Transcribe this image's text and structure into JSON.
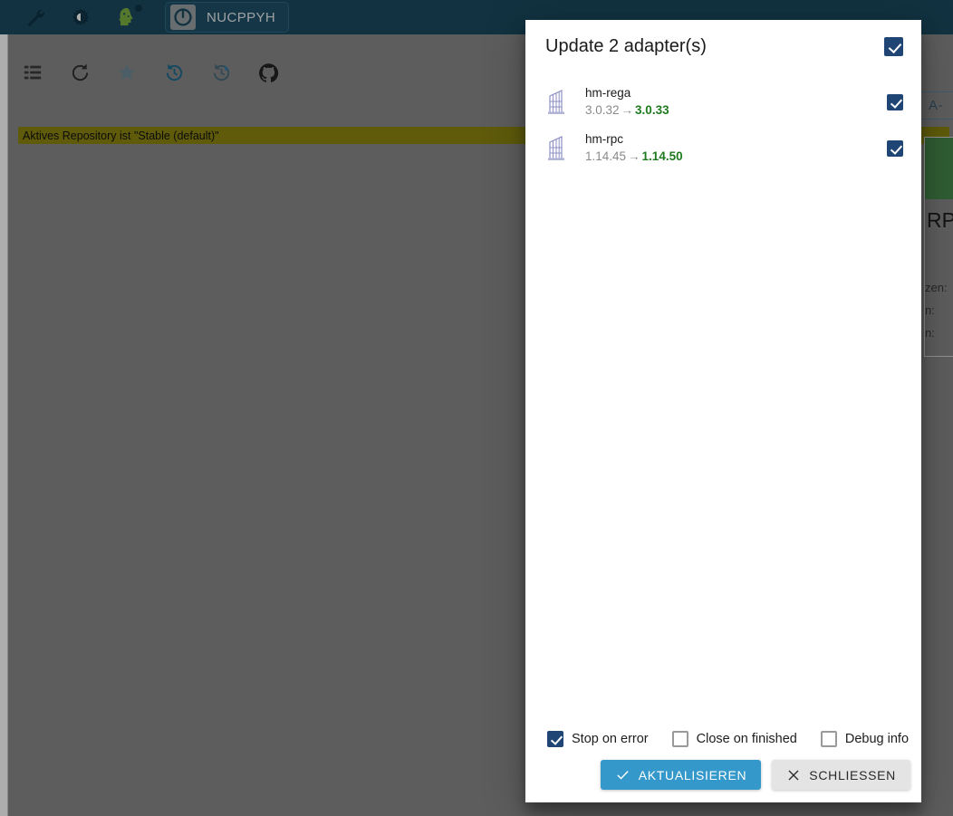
{
  "topbar": {
    "icons": [
      {
        "name": "wrench-icon",
        "label": "Tools"
      },
      {
        "name": "contrast-icon",
        "label": "Theme"
      },
      {
        "name": "head-expert-icon",
        "label": "Expert mode"
      }
    ],
    "host_button": {
      "label": "NUCPPYH",
      "icon": "power-logo-icon"
    }
  },
  "toolbar": {
    "icons": [
      {
        "name": "list-view-icon",
        "label": "List view"
      },
      {
        "name": "refresh-icon",
        "label": "Refresh"
      },
      {
        "name": "star-icon",
        "label": "Favorites"
      },
      {
        "name": "update-available-icon",
        "label": "Check updates"
      },
      {
        "name": "update-all-icon",
        "label": "Update all"
      },
      {
        "name": "github-icon",
        "label": "GitHub"
      }
    ]
  },
  "repository": {
    "banner": "Aktives Repository ist \"Stable (default)\""
  },
  "background": {
    "sliver_button": "A-",
    "sliver_title": "RP(",
    "sliver_lines": [
      "zen:",
      "n:",
      "n:"
    ]
  },
  "dialog": {
    "title": "Update 2 adapter(s)",
    "select_all_checked": true,
    "adapters": [
      {
        "name": "hm-rega",
        "icon": "adapter-icon",
        "version_old": "3.0.32",
        "arrow": "→",
        "version_new": "3.0.33",
        "checked": true
      },
      {
        "name": "hm-rpc",
        "icon": "adapter-icon",
        "version_old": "1.14.45",
        "arrow": "→",
        "version_new": "1.14.50",
        "checked": true
      }
    ],
    "options": [
      {
        "label": "Stop on error",
        "checked": true
      },
      {
        "label": "Close on finished",
        "checked": false
      },
      {
        "label": "Debug info",
        "checked": false
      }
    ],
    "buttons": {
      "confirm": {
        "label": "AKTUALISIEREN",
        "icon": "check-icon"
      },
      "close": {
        "label": "SCHLIESSEN",
        "icon": "close-icon"
      }
    }
  },
  "colors": {
    "topbar": "#1b4a60",
    "accent_primary": "#3498ca",
    "checkbox_checked": "#1e4573",
    "version_new": "#1f7a1f",
    "banner": "#8d8711",
    "backdrop": "rgba(0,0,0,0.32)"
  }
}
